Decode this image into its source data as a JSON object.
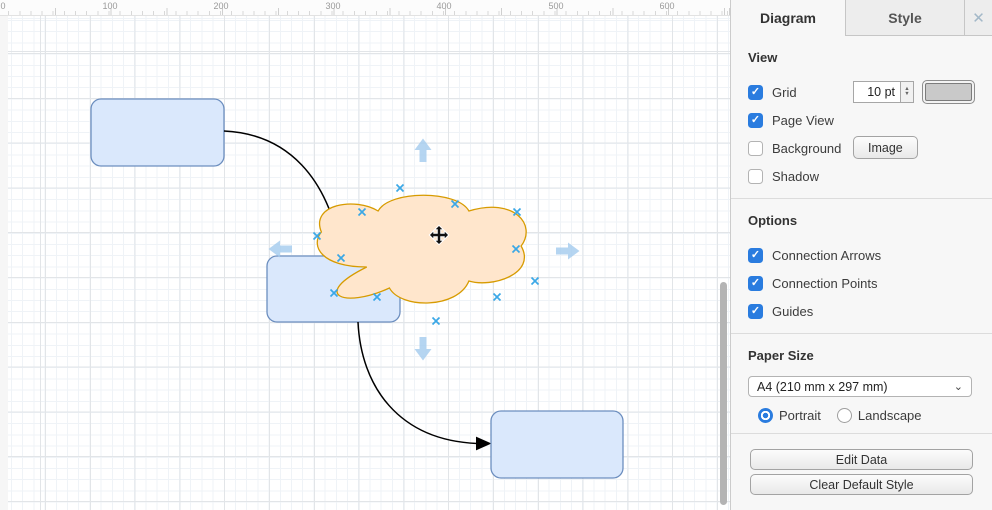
{
  "colors": {
    "accent": "#2a7cdf",
    "rect-fill": "#dae8fc",
    "rect-stroke": "#6c8ebf",
    "cloud-fill": "#ffe6cc",
    "cloud-stroke": "#d79b00",
    "edge": "#000000",
    "connection-point": "#30a3e6",
    "direction-arrow": "#a3cbed",
    "scrollbar": "#b4b4b4",
    "close-icon": "#a3b8c8"
  },
  "canvas": {
    "ruler_labels": [
      "0",
      "100",
      "200",
      "300",
      "400",
      "500",
      "600"
    ]
  },
  "icons": {
    "close": "✕",
    "chevron_down": "⌄",
    "spinner_up": "▲",
    "spinner_down": "▼",
    "check": "✓"
  },
  "panel": {
    "tabs": [
      {
        "label": "Diagram",
        "active": true
      },
      {
        "label": "Style",
        "active": false
      }
    ],
    "view": {
      "title": "View",
      "grid": {
        "label": "Grid",
        "checked": true,
        "size_value": "10 pt"
      },
      "page_view": {
        "label": "Page View",
        "checked": true
      },
      "background": {
        "label": "Background",
        "checked": false,
        "image_button": "Image"
      },
      "shadow": {
        "label": "Shadow",
        "checked": false
      }
    },
    "options": {
      "title": "Options",
      "connection_arrows": {
        "label": "Connection Arrows",
        "checked": true
      },
      "connection_points": {
        "label": "Connection Points",
        "checked": true
      },
      "guides": {
        "label": "Guides",
        "checked": true
      }
    },
    "paper_size": {
      "title": "Paper Size",
      "value": "A4 (210 mm x 297 mm)",
      "portrait": {
        "label": "Portrait",
        "selected": true
      },
      "landscape": {
        "label": "Landscape",
        "selected": false
      }
    },
    "actions": {
      "edit_data": "Edit Data",
      "clear_default_style": "Clear Default Style"
    }
  }
}
